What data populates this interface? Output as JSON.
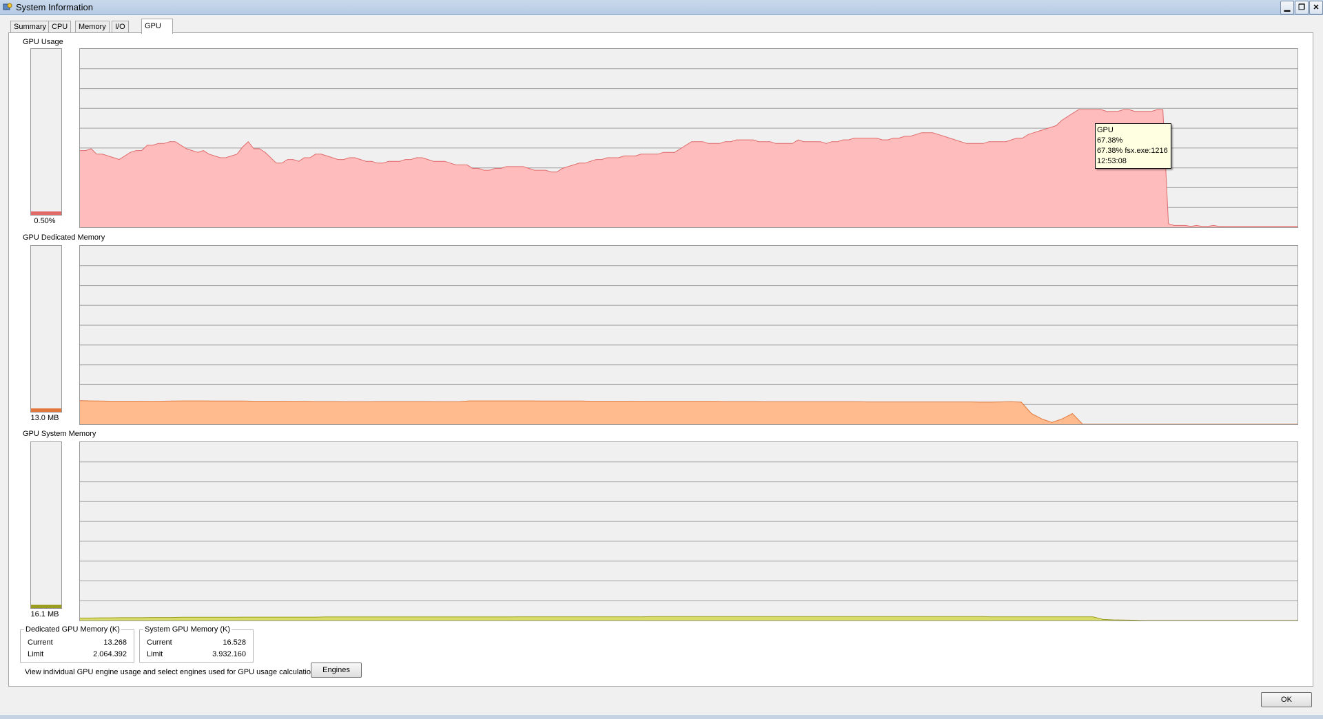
{
  "window": {
    "title": "System Information"
  },
  "title_buttons": {
    "minimize": "▁",
    "restore": "❐",
    "close": "✕"
  },
  "tabs": [
    {
      "label": "Summary"
    },
    {
      "label": "CPU"
    },
    {
      "label": "Memory"
    },
    {
      "label": "I/O"
    },
    {
      "label": "GPU",
      "active": true
    }
  ],
  "gpu_usage": {
    "label": "GPU Usage",
    "meter_value": "0.50%",
    "meter_fraction": 0.005
  },
  "gpu_dedicated_memory": {
    "label": "GPU Dedicated Memory",
    "meter_value": "13.0 MB",
    "meter_fraction": 0.01
  },
  "gpu_system_memory": {
    "label": "GPU System Memory",
    "meter_value": "16.1 MB",
    "meter_fraction": 0.01
  },
  "tooltip": {
    "line1": "GPU",
    "line2": "67.38%",
    "line3": "67.38% fsx.exe:1216",
    "line4": "12:53:08"
  },
  "dedicated_group": {
    "title": "Dedicated GPU Memory (K)",
    "current_label": "Current",
    "current_value": "13.268",
    "limit_label": "Limit",
    "limit_value": "2.064.392"
  },
  "system_group": {
    "title": "System GPU Memory (K)",
    "current_label": "Current",
    "current_value": "16.528",
    "limit_label": "Limit",
    "limit_value": "3.932.160"
  },
  "engines": {
    "text": "View individual GPU engine usage and select engines used for GPU usage calculations:",
    "button_label": "Engines"
  },
  "ok_button": {
    "label": "OK"
  },
  "colors": {
    "usage_fill": "#ffbcbc",
    "usage_line": "#e06b6b",
    "dedicated_fill": "#ffbb8e",
    "dedicated_line": "#e0783c",
    "system_fill": "#d8dc6a",
    "system_line": "#9a9d1e",
    "grid": "#a0a0a0",
    "graph_bg": "#f0f0f0"
  },
  "chart_data": [
    {
      "type": "area",
      "series": [
        {
          "values": [
            43,
            43,
            44,
            41,
            41,
            40,
            39,
            38,
            40,
            42,
            43,
            43,
            46,
            46,
            47,
            47,
            48,
            48,
            46,
            44,
            43,
            42,
            43,
            41,
            40,
            39,
            39,
            40,
            41,
            45,
            48,
            44,
            44,
            42,
            39,
            36,
            36,
            38,
            38,
            37,
            39,
            39,
            41,
            41,
            40,
            39,
            38,
            38,
            39,
            39,
            38,
            37,
            37,
            36,
            36,
            37,
            37,
            37,
            38,
            38,
            39,
            39,
            38,
            37,
            37,
            37,
            36,
            35,
            35,
            35,
            33,
            33,
            32,
            32,
            33,
            33,
            34,
            34,
            34,
            34,
            33,
            32,
            32,
            32,
            31,
            31,
            33,
            34,
            35,
            36,
            36,
            37,
            38,
            38,
            39,
            39,
            39,
            40,
            40,
            40,
            41,
            41,
            41,
            41,
            42,
            42,
            42,
            44,
            46,
            48,
            48,
            48,
            47,
            47,
            47,
            48,
            48,
            49,
            49,
            49,
            49,
            48,
            48,
            48,
            47,
            47,
            47,
            47,
            49,
            48,
            48,
            48,
            48,
            47,
            48,
            48,
            49,
            49,
            50,
            50,
            50,
            50,
            50,
            49,
            49,
            50,
            50,
            51,
            51,
            52,
            53,
            53,
            53,
            52,
            51,
            50,
            49,
            48,
            47,
            47,
            47,
            47,
            48,
            48,
            48,
            48,
            49,
            50,
            50,
            52,
            53,
            54,
            55,
            56,
            57,
            60,
            62,
            64,
            66,
            66,
            66,
            66,
            66,
            65,
            65,
            65,
            66,
            66,
            65,
            65,
            65,
            65,
            66,
            66,
            2,
            1,
            1,
            1,
            0.5,
            1,
            0.5,
            0.5,
            1,
            0.5,
            0.5,
            0.5,
            0.5,
            0.5,
            0.5,
            0.5,
            0.5,
            0.5,
            0.5,
            0.5,
            0.5,
            0.5,
            0.5,
            0.5
          ]
        }
      ],
      "ylim": [
        0,
        100
      ],
      "grid": true
    },
    {
      "type": "area",
      "series": [
        {
          "values": [
            13.2,
            13.1,
            13.0,
            12.9,
            12.9,
            12.9,
            12.9,
            12.8,
            12.9,
            13.0,
            13.1,
            13.1,
            13.1,
            13.0,
            13.0,
            13.0,
            13.0,
            12.9,
            12.9,
            12.9,
            12.9,
            12.8,
            12.8,
            12.7,
            12.7,
            12.7,
            12.6,
            12.6,
            12.6,
            12.7,
            12.7,
            12.7,
            12.7,
            12.7,
            12.7,
            12.6,
            12.6,
            12.6,
            13.1,
            13.1,
            13.1,
            13.1,
            13.1,
            13.1,
            13.1,
            13.0,
            13.0,
            13.0,
            13.0,
            13.0,
            12.9,
            12.9,
            12.9,
            12.9,
            12.9,
            12.8,
            12.8,
            12.8,
            12.8,
            12.8,
            12.8,
            12.8,
            12.8,
            12.7,
            12.7,
            12.7,
            12.7,
            12.6,
            12.6,
            12.6,
            12.6,
            12.6,
            12.6,
            12.6,
            12.6,
            12.6,
            12.6,
            12.5,
            12.5,
            12.5,
            12.5,
            12.5,
            12.5,
            12.5,
            12.5,
            12.5,
            12.5,
            12.5,
            12.4,
            12.4,
            12.5,
            12.6,
            12.4,
            6,
            3,
            1,
            3,
            6,
            0,
            0,
            0,
            0,
            0,
            0,
            0,
            0,
            0,
            0,
            0,
            0,
            0,
            0,
            0,
            0,
            0,
            0,
            0,
            0,
            0,
            0
          ]
        }
      ],
      "ylim": [
        0,
        100
      ],
      "grid": true
    },
    {
      "type": "area",
      "series": [
        {
          "values": [
            1.4,
            1.4,
            1.5,
            1.5,
            1.6,
            1.6,
            1.6,
            1.7,
            1.7,
            1.7,
            1.8,
            1.8,
            1.8,
            1.8,
            1.8,
            1.8,
            1.9,
            1.9,
            1.9,
            1.9,
            1.9,
            1.9,
            1.9,
            1.9,
            2.0,
            2.0,
            2.0,
            2.0,
            2.0,
            2.0,
            2.0,
            2.0,
            2.0,
            2.0,
            2.0,
            2.0,
            2.0,
            2.0,
            2.0,
            2.0,
            2.0,
            2.0,
            2.0,
            2.1,
            2.1,
            2.1,
            2.1,
            2.1,
            2.1,
            2.1,
            2.1,
            2.1,
            2.1,
            2.1,
            2.1,
            2.1,
            2.2,
            2.2,
            2.2,
            2.2,
            2.2,
            2.2,
            2.2,
            2.2,
            2.2,
            2.2,
            2.2,
            2.2,
            2.2,
            2.2,
            2.2,
            2.2,
            2.2,
            2.2,
            2.2,
            2.2,
            2.2,
            2.2,
            2.2,
            2.2,
            2.2,
            2.2,
            2.2,
            2.2,
            2.2,
            2.2,
            2.2,
            2.2,
            2.2,
            2.1,
            2.1,
            2.1,
            2.1,
            2.1,
            2.1,
            2.1,
            2.1,
            2.1,
            2.1,
            2.1,
            0.6,
            0.4,
            0.3,
            0.2,
            0,
            0,
            0,
            0,
            0,
            0,
            0,
            0,
            0,
            0,
            0,
            0,
            0,
            0,
            0,
            0
          ]
        }
      ],
      "ylim": [
        0,
        100
      ],
      "grid": true
    }
  ]
}
